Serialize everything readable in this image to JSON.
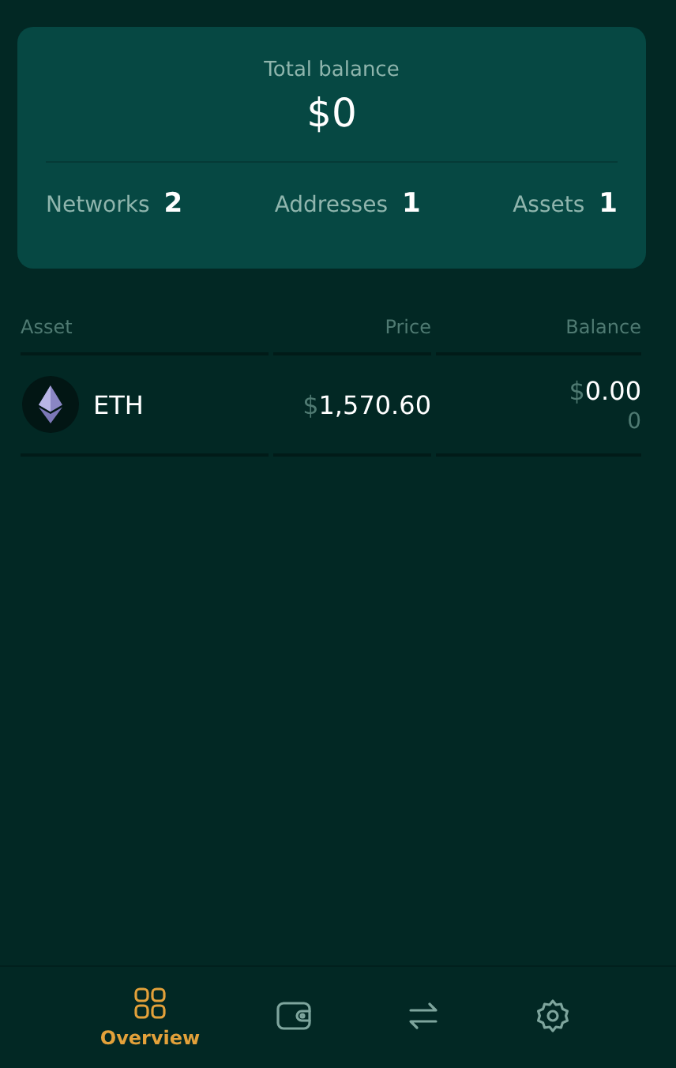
{
  "summary": {
    "label": "Total balance",
    "total": "$0",
    "stats": [
      {
        "label": "Networks",
        "value": "2"
      },
      {
        "label": "Addresses",
        "value": "1"
      },
      {
        "label": "Assets",
        "value": "1"
      }
    ]
  },
  "table": {
    "columns": [
      "Asset",
      "Price",
      "Balance"
    ],
    "rows": [
      {
        "asset": "ETH",
        "price": {
          "symbol": "$",
          "amount": "1,570.60"
        },
        "balance": {
          "symbol": "$",
          "amount": "0.00"
        },
        "quantity": "0"
      }
    ]
  },
  "nav": [
    {
      "kind": "grid",
      "label": "Overview",
      "selected": true
    },
    {
      "kind": "wallet",
      "selected": false
    },
    {
      "kind": "swap",
      "selected": false
    },
    {
      "kind": "settings",
      "selected": false
    }
  ]
}
